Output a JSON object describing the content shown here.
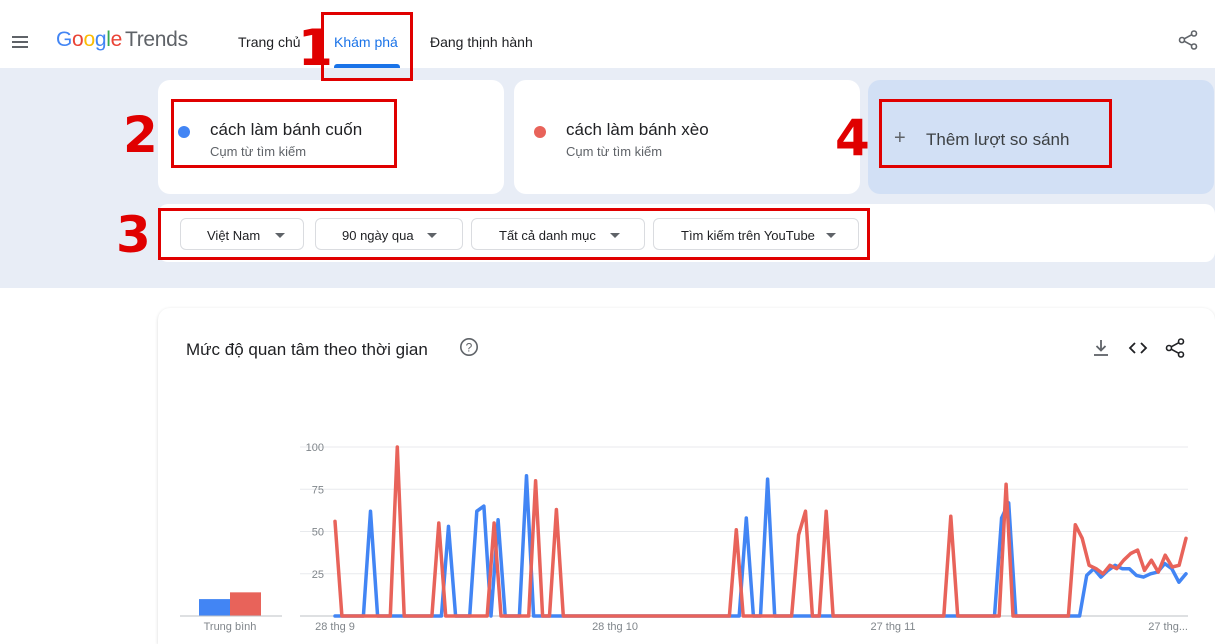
{
  "header": {
    "logo_google": "Google",
    "logo_trends": "Trends",
    "nav": [
      "Trang chủ",
      "Khám phá",
      "Đang thịnh hành"
    ],
    "active_nav": "Khám phá",
    "icons": {
      "menu": "menu-icon",
      "share": "share-icon"
    }
  },
  "compare": {
    "terms": [
      {
        "title": "cách làm bánh cuốn",
        "subtitle": "Cụm từ tìm kiếm",
        "color": "#4285f4"
      },
      {
        "title": "cách làm bánh xèo",
        "subtitle": "Cụm từ tìm kiếm",
        "color": "#e8635a"
      }
    ],
    "add_label": "Thêm lượt so sánh",
    "add_icon": "plus-icon"
  },
  "filters": [
    {
      "label": "Việt Nam"
    },
    {
      "label": "90 ngày qua"
    },
    {
      "label": "Tất cả danh mục"
    },
    {
      "label": "Tìm kiếm trên YouTube"
    }
  ],
  "annotations": [
    "1",
    "2",
    "3",
    "4"
  ],
  "colors": {
    "accent": "#1a73e8",
    "annotation": "#e00000",
    "band": "#e8edf6",
    "series1": "#4285f4",
    "series2": "#e8635a"
  },
  "chart_section": {
    "title": "Mức độ quan tâm theo thời gian",
    "icons": [
      "help-icon",
      "download-icon",
      "embed-icon",
      "share-icon"
    ]
  },
  "chart_data": {
    "type": "line",
    "title": "Mức độ quan tâm theo thời gian",
    "ylim": [
      0,
      100
    ],
    "y_ticks": [
      "25",
      "50",
      "75",
      "100"
    ],
    "x_tick_labels": [
      "28 thg 9",
      "28 thg 10",
      "27 thg 11",
      "27 thg..."
    ],
    "grid": true,
    "series": [
      {
        "name": "cách làm bánh cuốn",
        "color": "#4285f4",
        "average": 10,
        "values": [
          0,
          0,
          0,
          0,
          0,
          62,
          0,
          0,
          0,
          0,
          0,
          0,
          0,
          0,
          0,
          0,
          53,
          0,
          0,
          0,
          62,
          65,
          0,
          57,
          0,
          0,
          0,
          83,
          0,
          0,
          0,
          0,
          0,
          0,
          0,
          0,
          0,
          0,
          0,
          0,
          0,
          0,
          0,
          0,
          0,
          0,
          0,
          0,
          0,
          0,
          0,
          0,
          0,
          0,
          0,
          0,
          0,
          0,
          58,
          0,
          0,
          81,
          0,
          0,
          0,
          0,
          0,
          0,
          0,
          0,
          0,
          0,
          0,
          0,
          0,
          0,
          0,
          0,
          0,
          0,
          0,
          0,
          0,
          0,
          0,
          0,
          0,
          0,
          0,
          0,
          0,
          0,
          0,
          0,
          58,
          67,
          0,
          0,
          0,
          0,
          0,
          0,
          0,
          0,
          0,
          0,
          24,
          28,
          23,
          27,
          30,
          28,
          28,
          24,
          23,
          25,
          26,
          31,
          28,
          20,
          25
        ]
      },
      {
        "name": "cách làm bánh xèo",
        "color": "#e8635a",
        "average": 14,
        "values": [
          56,
          0,
          0,
          0,
          0,
          0,
          0,
          0,
          0,
          100,
          0,
          0,
          0,
          0,
          0,
          55,
          0,
          0,
          0,
          0,
          0,
          0,
          0,
          55,
          0,
          0,
          0,
          0,
          0,
          80,
          0,
          0,
          63,
          0,
          0,
          0,
          0,
          0,
          0,
          0,
          0,
          0,
          0,
          0,
          0,
          0,
          0,
          0,
          0,
          0,
          0,
          0,
          0,
          0,
          0,
          0,
          0,
          0,
          51,
          0,
          0,
          0,
          0,
          0,
          0,
          0,
          0,
          48,
          62,
          0,
          0,
          62,
          0,
          0,
          0,
          0,
          0,
          0,
          0,
          0,
          0,
          0,
          0,
          0,
          0,
          0,
          0,
          0,
          0,
          59,
          0,
          0,
          0,
          0,
          0,
          0,
          0,
          78,
          0,
          0,
          0,
          0,
          0,
          0,
          0,
          0,
          0,
          54,
          46,
          30,
          28,
          25,
          30,
          28,
          33,
          37,
          39,
          27,
          33,
          26,
          36,
          29,
          30,
          46
        ]
      }
    ],
    "average_label": "Trung bình"
  }
}
